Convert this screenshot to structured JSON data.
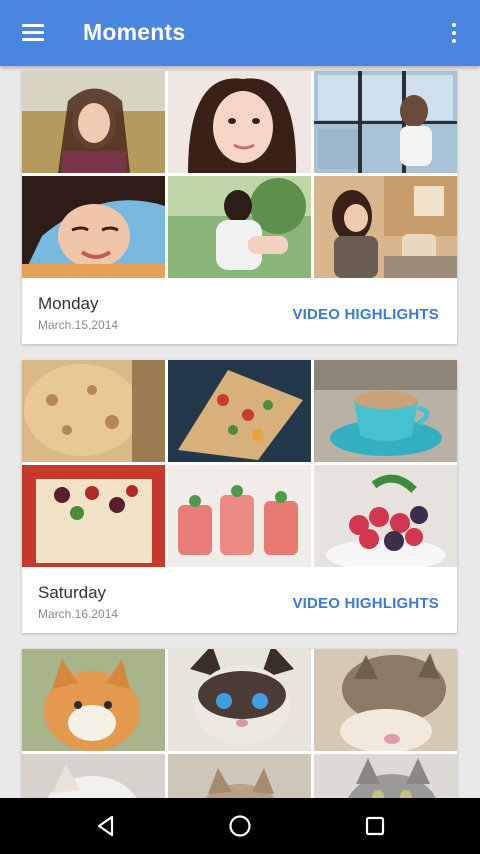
{
  "app": {
    "title": "Moments"
  },
  "header": {
    "menu_icon": "hamburger-menu-icon",
    "more_icon": "vertical-dots-icon"
  },
  "moments": [
    {
      "day": "Monday",
      "date": "March.15.2014",
      "action": "VIDEO HIGHLIGHTS",
      "photos": [
        "girl-in-field",
        "girl-smiling-portrait",
        "girl-by-window",
        "girl-laughing-closeup",
        "girl-sitting-outdoors",
        "girl-on-couch-with-phone"
      ]
    },
    {
      "day": "Saturday",
      "date": "March.16.2014",
      "action": "VIDEO HIGHLIGHTS",
      "photos": [
        "flatbread",
        "pizza-on-wood",
        "teacup-on-saucer",
        "dessert-with-berries",
        "pink-drinks-with-mint",
        "raspberries-and-blackberries"
      ]
    },
    {
      "photos": [
        "orange-kitten",
        "siamese-cat",
        "tabby-kittens",
        "white-cat",
        "cat-on-floor",
        "grey-cat"
      ]
    }
  ],
  "nav": {
    "back_icon": "back-triangle-icon",
    "home_icon": "home-circle-icon",
    "recents_icon": "recents-square-icon"
  },
  "colors": {
    "appbar": "#4a86e0",
    "accent": "#3b7bd0"
  }
}
